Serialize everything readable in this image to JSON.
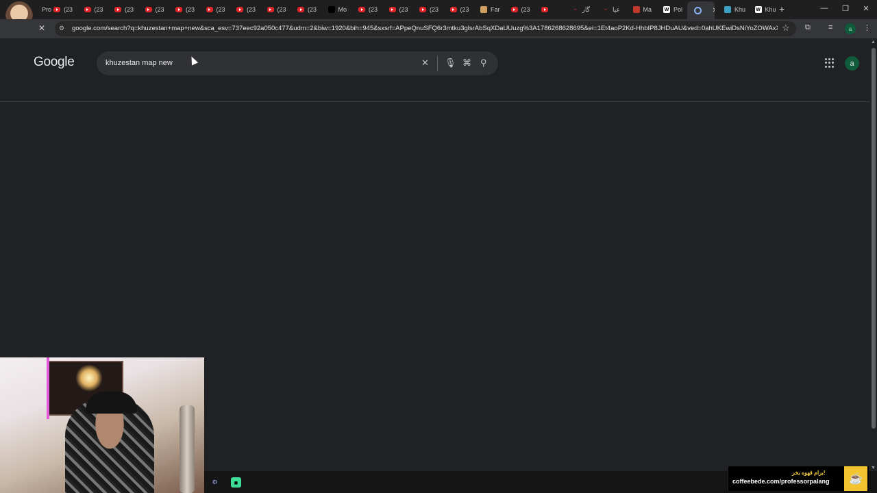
{
  "tabs": [
    {
      "label": "Pro",
      "icon": "profile-icon"
    },
    {
      "label": "(23",
      "icon": "youtube-icon"
    },
    {
      "label": "(23",
      "icon": "youtube-icon"
    },
    {
      "label": "(23",
      "icon": "youtube-icon"
    },
    {
      "label": "(23",
      "icon": "youtube-icon"
    },
    {
      "label": "(23",
      "icon": "youtube-icon"
    },
    {
      "label": "(23",
      "icon": "youtube-icon"
    },
    {
      "label": "(23",
      "icon": "youtube-icon"
    },
    {
      "label": "(23",
      "icon": "youtube-icon"
    },
    {
      "label": "(23",
      "icon": "youtube-icon"
    },
    {
      "label": "Mo",
      "icon": "m-icon"
    },
    {
      "label": "(23",
      "icon": "youtube-icon"
    },
    {
      "label": "(23",
      "icon": "youtube-icon"
    },
    {
      "label": "(23",
      "icon": "youtube-icon"
    },
    {
      "label": "(23",
      "icon": "youtube-icon"
    },
    {
      "label": "Far",
      "icon": "pen-icon"
    },
    {
      "label": "(23",
      "icon": "youtube-icon"
    },
    {
      "label": "",
      "icon": "youtube-icon"
    },
    {
      "label": "گار",
      "icon": "dash-icon"
    },
    {
      "label": "عیا",
      "icon": "dash-icon"
    },
    {
      "label": "Ma",
      "icon": "chart-icon"
    },
    {
      "label": "Pol",
      "icon": "wikipedia-icon"
    },
    {
      "label": "",
      "icon": "google-icon",
      "active": true
    },
    {
      "label": "Khu",
      "icon": "square-icon"
    },
    {
      "label": "Khu",
      "icon": "wikipedia-icon"
    }
  ],
  "toolbar": {
    "url": "google.com/search?q=khuzestan+map+new&sca_esv=737eec92a050c477&udm=2&biw=1920&bih=945&sxsrf=APpeQnuSFQ6r3mtku3glsrAbSqXDaUUuzg%3A1786268628695&ei=1Et4aoP2Kd-HhbIP8JHDuAU&ved=0ahUKEwiDsNiYoZOWAxXfQ0..."
  },
  "google": {
    "logo": "Google",
    "query": "khuzestan map new",
    "account_initial": "a",
    "toolbar_profile_initial": "a"
  },
  "overlay": {
    "coffee_text_fa": "برام قهوه بخر!",
    "coffee_url": "coffeebede.com/professorpalang"
  },
  "colors": {
    "page_bg": "#202124",
    "searchbox_bg": "#303134",
    "accent_avatar": "#0f5b3b",
    "coffee_yellow": "#f4c430"
  }
}
